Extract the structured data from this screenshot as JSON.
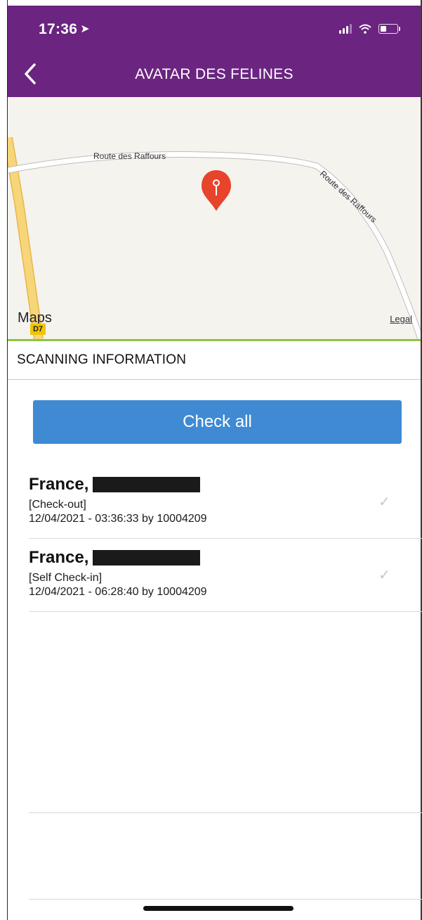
{
  "status_bar": {
    "time": "17:36",
    "location_icon": "location-arrow-icon",
    "signal_icon": "cellular-signal-icon",
    "wifi_icon": "wifi-icon",
    "battery_icon": "battery-icon",
    "battery_level": 0.35
  },
  "nav": {
    "back_icon": "chevron-left-icon",
    "title": "AVATAR DES FELINES"
  },
  "map": {
    "road_label_1": "Route des Raffours",
    "road_label_2": "Route des Raffours",
    "road_badge": "D7",
    "logo_text": "Maps",
    "legal_label": "Legal",
    "pin_icon": "map-pin-icon",
    "colors": {
      "background": "#f5f3ee",
      "pin": "#e8432b",
      "road_yellow": "#f7d67a"
    }
  },
  "section": {
    "title": "SCANNING INFORMATION"
  },
  "actions": {
    "check_all_label": "Check all",
    "color": "#3f8ad3"
  },
  "items": [
    {
      "name_prefix": "France,",
      "status": "[Check-out]",
      "meta": "12/04/2021 - 03:36:33 by 10004209",
      "check_icon": "checkmark-icon"
    },
    {
      "name_prefix": "France,",
      "status": "[Self Check-in]",
      "meta": "12/04/2021 - 06:28:40 by 10004209",
      "check_icon": "checkmark-icon"
    }
  ],
  "theme": {
    "header_color": "#6b2480",
    "accent_line": "#8cc63f"
  }
}
